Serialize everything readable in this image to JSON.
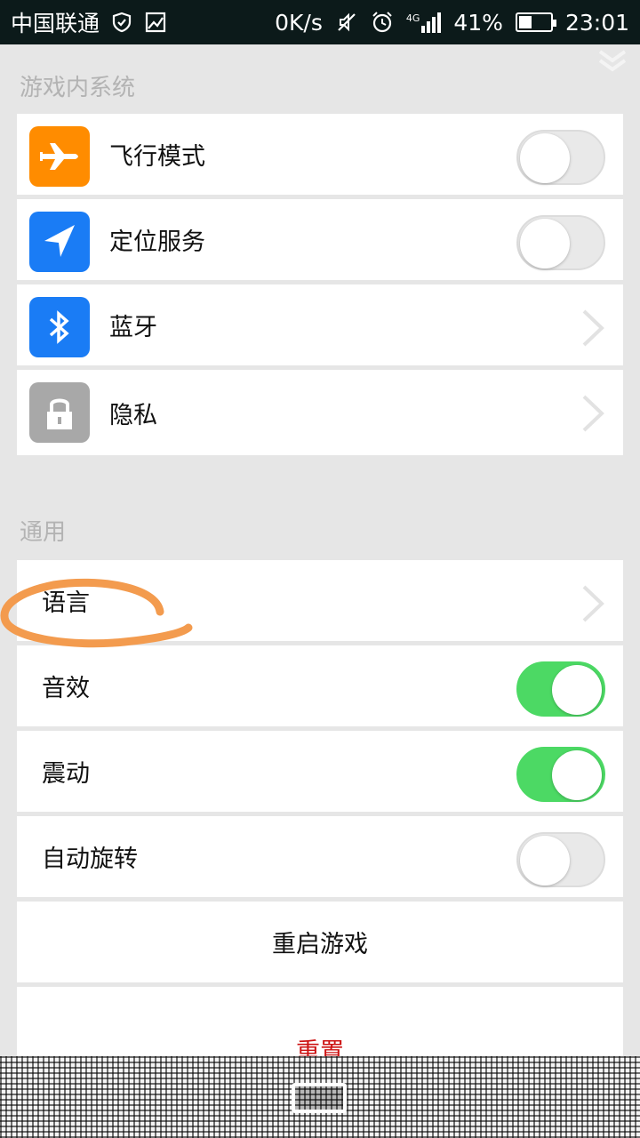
{
  "status_bar": {
    "carrier": "中国联通",
    "net_speed": "0K/s",
    "network_type": "4G",
    "battery": "41%",
    "battery_level": 0.41,
    "time": "23:01"
  },
  "sections": {
    "in_game_system": {
      "header": "游戏内系统",
      "items": [
        {
          "label": "飞行模式",
          "icon": "airplane-icon",
          "icon_color": "#ff8c00",
          "control": "toggle",
          "on": false
        },
        {
          "label": "定位服务",
          "icon": "location-arrow-icon",
          "icon_color": "#1a7cf5",
          "control": "toggle",
          "on": false
        },
        {
          "label": "蓝牙",
          "icon": "bluetooth-icon",
          "icon_color": "#1a7cf5",
          "control": "chevron"
        },
        {
          "label": "隐私",
          "icon": "lock-icon",
          "icon_color": "#a8a8a8",
          "control": "chevron"
        }
      ]
    },
    "general": {
      "header": "通用",
      "items": [
        {
          "label": "语言",
          "control": "chevron"
        },
        {
          "label": "音效",
          "control": "toggle",
          "on": true
        },
        {
          "label": "震动",
          "control": "toggle",
          "on": true
        },
        {
          "label": "自动旋转",
          "control": "toggle",
          "on": false
        }
      ],
      "restart_label": "重启游戏",
      "reset_label": "重置"
    }
  },
  "colors": {
    "background": "#e6e6e6",
    "toggle_on": "#4cd964",
    "annotation": "#f39b4e",
    "reset_text": "#cc1111"
  }
}
